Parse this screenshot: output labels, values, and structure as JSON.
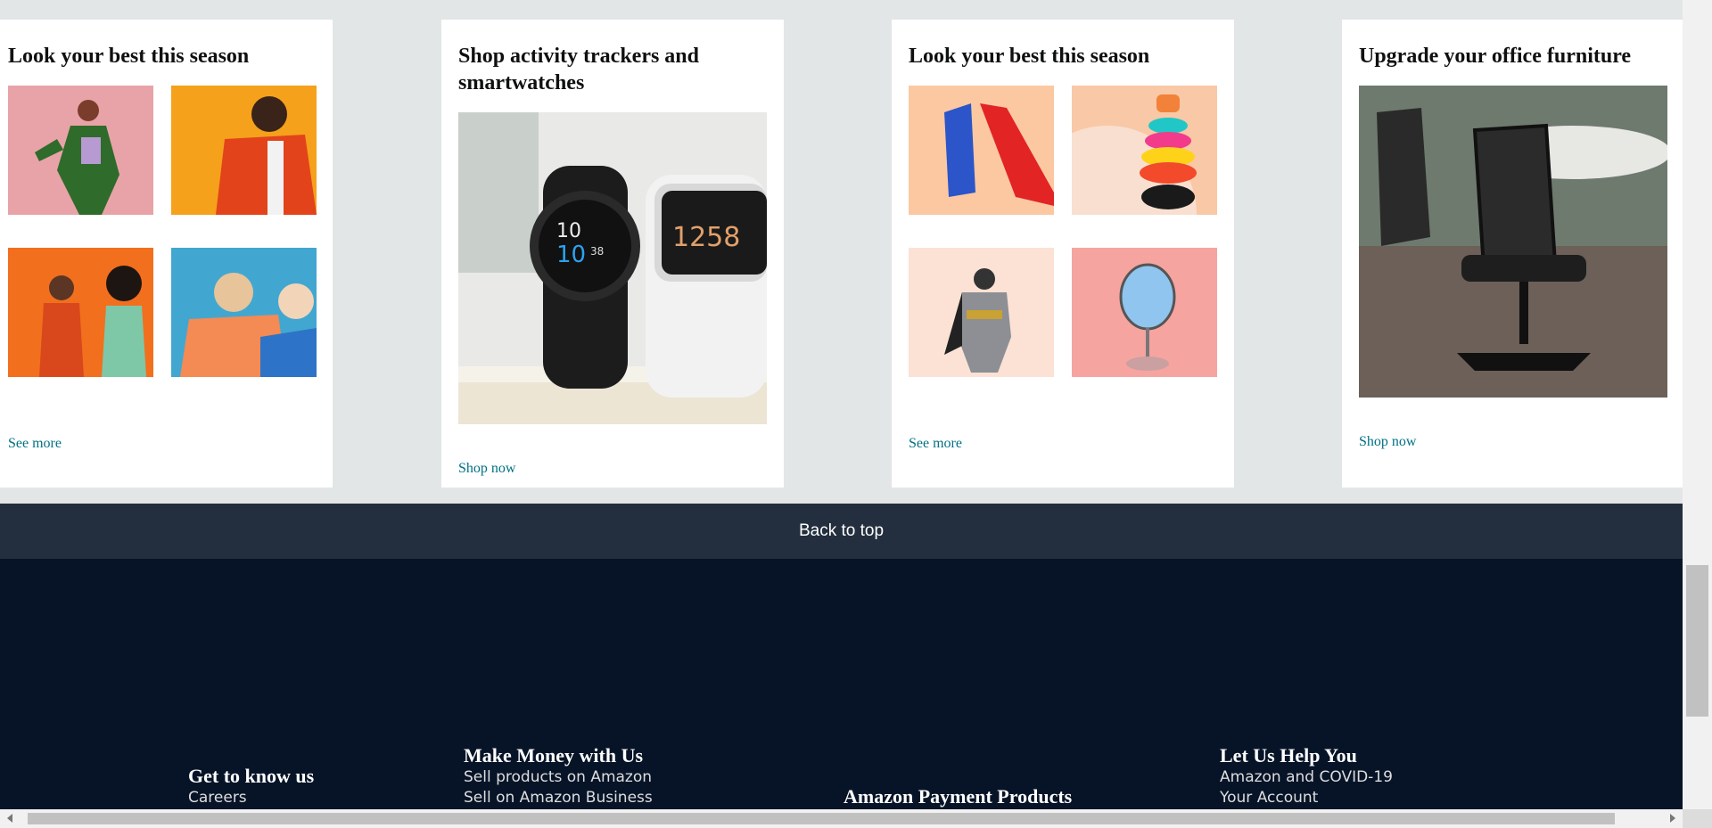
{
  "cards": [
    {
      "title": "Look your best this season",
      "cta": "See more"
    },
    {
      "title": "Shop activity trackers and smartwatches",
      "cta": "Shop now"
    },
    {
      "title": "Look your best this season",
      "cta": "See more"
    },
    {
      "title": "Upgrade your office furniture",
      "cta": "Shop now"
    }
  ],
  "back_to_top": "Back to top",
  "footer": {
    "col1": {
      "heading": "Get to know us",
      "links": [
        "Careers"
      ]
    },
    "col2": {
      "heading": "Make Money with Us",
      "links": [
        "Sell products on Amazon",
        "Sell on Amazon Business"
      ]
    },
    "col3": {
      "heading": "Amazon Payment Products",
      "links": []
    },
    "col4": {
      "heading": "Let Us Help You",
      "links": [
        "Amazon and COVID-19",
        "Your Account"
      ]
    }
  },
  "colors": {
    "link": "#007185",
    "footer_bg": "#071428",
    "backtop_bg": "#232f3e"
  }
}
